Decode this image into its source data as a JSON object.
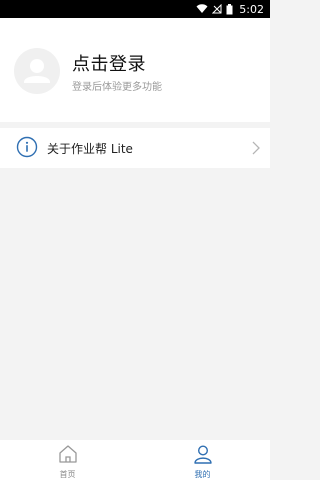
{
  "status_bar": {
    "time": "5:02",
    "icons": [
      "wifi-icon",
      "signal-off-icon",
      "battery-icon"
    ]
  },
  "profile": {
    "title": "点击登录",
    "subtitle": "登录后体验更多功能",
    "avatar_icon": "user-avatar-icon"
  },
  "menu": {
    "items": [
      {
        "icon": "info-icon",
        "label": "关于作业帮 Lite",
        "trailing_icon": "chevron-right-icon"
      }
    ]
  },
  "tabbar": {
    "tabs": [
      {
        "icon": "home-icon",
        "label": "首页",
        "active": false
      },
      {
        "icon": "person-icon",
        "label": "我的",
        "active": true
      }
    ],
    "active_color": "#2f6fb2",
    "inactive_color": "#888888"
  }
}
